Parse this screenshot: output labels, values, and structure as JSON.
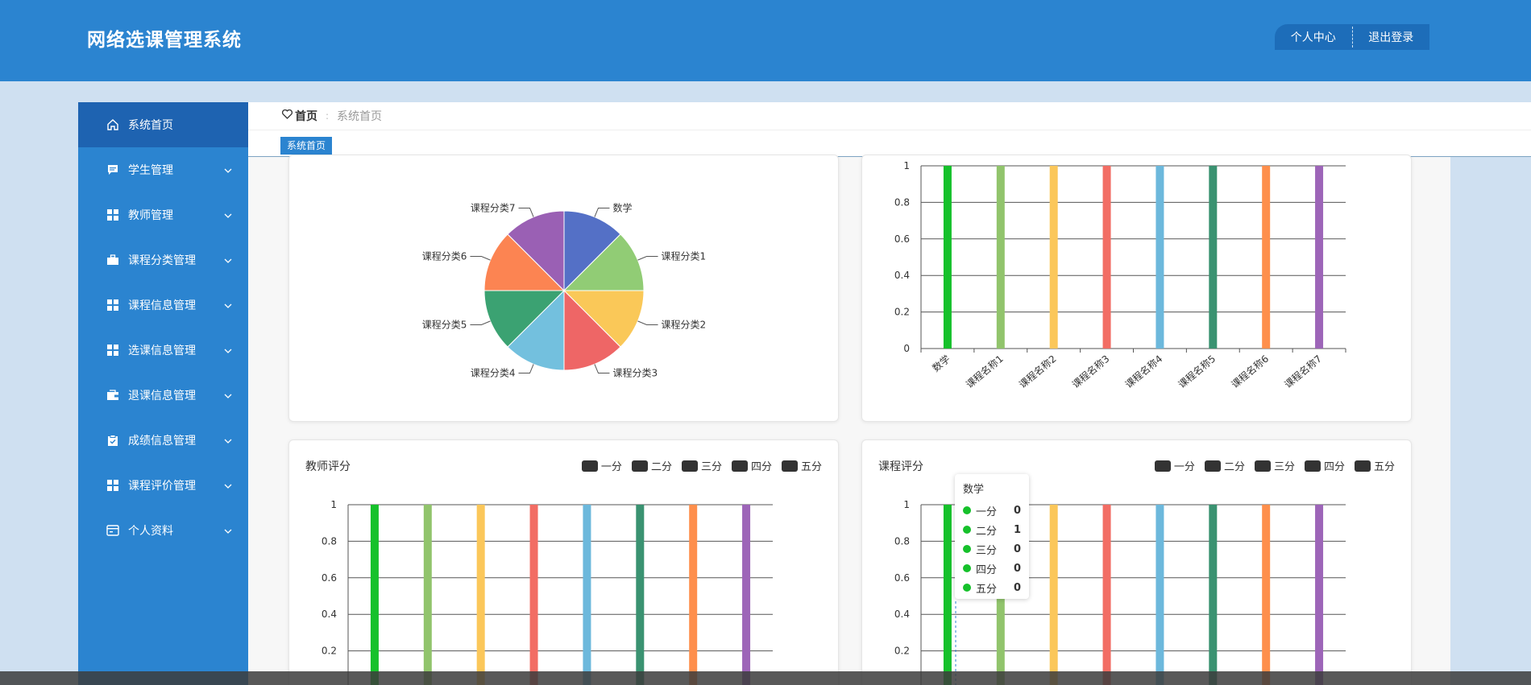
{
  "app": {
    "title": "网络选课管理系统"
  },
  "header": {
    "profile_label": "个人中心",
    "logout_label": "退出登录"
  },
  "sidebar": {
    "items": [
      {
        "label": "系统首页",
        "icon": "home-icon",
        "active": true
      },
      {
        "label": "学生管理",
        "icon": "chat-icon"
      },
      {
        "label": "教师管理",
        "icon": "grid-icon"
      },
      {
        "label": "课程分类管理",
        "icon": "briefcase-icon"
      },
      {
        "label": "课程信息管理",
        "icon": "grid-icon"
      },
      {
        "label": "选课信息管理",
        "icon": "grid-icon"
      },
      {
        "label": "退课信息管理",
        "icon": "wallet-icon"
      },
      {
        "label": "成绩信息管理",
        "icon": "clipboard-icon"
      },
      {
        "label": "课程评价管理",
        "icon": "grid-icon"
      },
      {
        "label": "个人资料",
        "icon": "card-icon"
      }
    ]
  },
  "breadcrumb": {
    "home": "首页",
    "current": "系统首页"
  },
  "tabs": [
    {
      "label": "系统首页"
    }
  ],
  "colors": {
    "brand": "#2b84d0",
    "palette": [
      "#16c12b",
      "#91c46c",
      "#fbc75a",
      "#f26d64",
      "#6cb8dc",
      "#3a9271",
      "#fe8f4c",
      "#9d65b8"
    ],
    "pie_palette": [
      "#5470c6",
      "#91cc75",
      "#fac858",
      "#ee6666",
      "#73c0de",
      "#3ba272",
      "#fc8452",
      "#9a60b4"
    ]
  },
  "legend": [
    "一分",
    "二分",
    "三分",
    "四分",
    "五分"
  ],
  "chart_data": [
    {
      "type": "pie",
      "categories": [
        "数学",
        "课程分类1",
        "课程分类2",
        "课程分类3",
        "课程分类4",
        "课程分类5",
        "课程分类6",
        "课程分类7"
      ],
      "values": [
        1,
        1,
        1,
        1,
        1,
        1,
        1,
        1
      ]
    },
    {
      "type": "bar",
      "categories": [
        "数学",
        "课程名称1",
        "课程名称2",
        "课程名称3",
        "课程名称4",
        "课程名称5",
        "课程名称6",
        "课程名称7"
      ],
      "values": [
        1,
        1,
        1,
        1,
        1,
        1,
        1,
        1
      ],
      "ylim": [
        0,
        1
      ],
      "yticks": [
        "0",
        "0.2",
        "0.4",
        "0.6",
        "0.8",
        "1"
      ]
    },
    {
      "type": "bar",
      "title": "教师评分",
      "values": [
        1,
        1,
        1,
        1,
        1,
        1,
        1,
        1
      ],
      "ylim": [
        0,
        1
      ],
      "yticks": [
        "0.2",
        "0.4",
        "0.6",
        "0.8",
        "1"
      ]
    },
    {
      "type": "bar",
      "title": "课程评分",
      "values": [
        1,
        1,
        1,
        1,
        1,
        1,
        1,
        1
      ],
      "ylim": [
        0,
        1
      ],
      "yticks": [
        "0.2",
        "0.4",
        "0.6",
        "0.8",
        "1"
      ]
    }
  ],
  "tooltip": {
    "title": "数学",
    "rows": [
      {
        "label": "一分",
        "value": "0"
      },
      {
        "label": "二分",
        "value": "1"
      },
      {
        "label": "三分",
        "value": "0"
      },
      {
        "label": "四分",
        "value": "0"
      },
      {
        "label": "五分",
        "value": "0"
      }
    ]
  }
}
